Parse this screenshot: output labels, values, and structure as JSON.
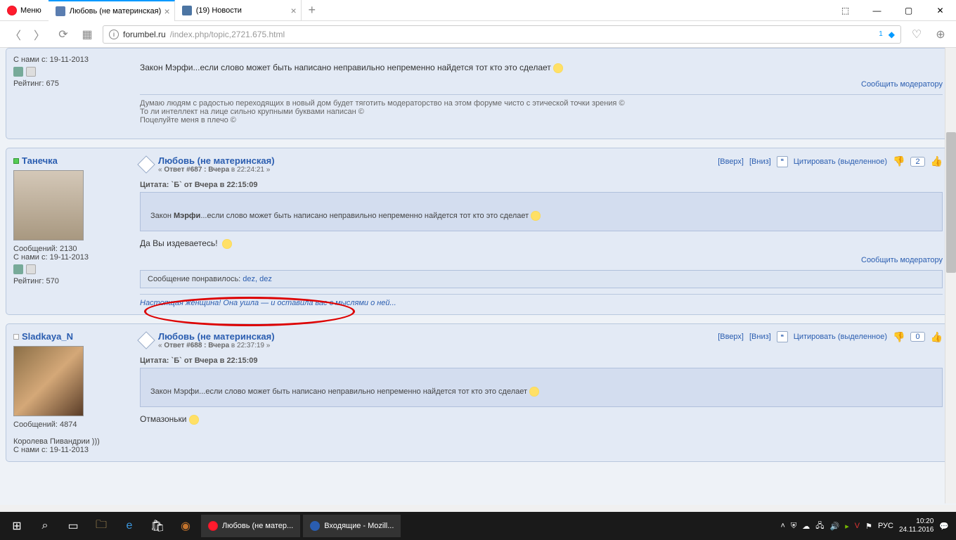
{
  "browser": {
    "menu_label": "Меню",
    "tabs": [
      {
        "title": "Любовь (не материнская)",
        "active": true
      },
      {
        "title": "(19) Новости",
        "active": false
      }
    ],
    "url_domain": "forumbel.ru",
    "url_path": "/index.php/topic,2721.675.html",
    "badge_count": "1"
  },
  "posts": [
    {
      "joined_label": "С нами с:",
      "joined_date": "19-11-2013",
      "rating_label": "Рейтинг:",
      "rating": "675",
      "body": "Закон Мэрфи...если слово может быть написано неправильно непременно найдется тот кто это сделает",
      "report": "Сообщить модератору",
      "sig1": "Думаю людям с радостью переходящих в новый дом будет тяготить модераторство на этом форуме чисто с этической точки зрения ©",
      "sig2": "То ли интеллект на лице сильно крупными буквами написан ©",
      "sig3": "Поцелуйте меня в плечо ©"
    },
    {
      "username": "Танечка",
      "online": true,
      "posts_label": "Сообщений:",
      "posts_count": "2130",
      "joined_label": "С нами с:",
      "joined_date": "19-11-2013",
      "rating_label": "Рейтинг:",
      "rating": "570",
      "title": "Любовь (не материнская)",
      "meta_prefix": "« ",
      "reply_label": "Ответ #687 : Вчера",
      "reply_time": " в 22:24:21 »",
      "quote_header": "Цитата: `Б` от Вчера в 22:15:09",
      "quote_prefix": "Закон ",
      "quote_bold": "Мэрфи",
      "quote_rest": "...если слово может быть написано неправильно непременно найдется тот кто это сделает",
      "body": "Да Вы издеваетесь!",
      "report": "Сообщить модератору",
      "liked_label": "Сообщение понравилось: ",
      "liked_users": "dez, dez",
      "signature": "Настоящая женщина! Она ушла — и оставила вас с мыслями о ней...",
      "actions": {
        "up": "[Вверх]",
        "down": "[Вниз]",
        "quote": "Цитировать (выделенное)",
        "likes": "2"
      }
    },
    {
      "username": "Sladkaya_N",
      "online": false,
      "posts_label": "Сообщений:",
      "posts_count": "4874",
      "extra_line": "Королева Пивандрии )))",
      "joined_label": "С нами с:",
      "joined_date": "19-11-2013",
      "title": "Любовь (не материнская)",
      "reply_label": "Ответ #688 : Вчера",
      "reply_time": " в 22:37:19 »",
      "quote_header": "Цитата: `Б` от Вчера в 22:15:09",
      "quote_text": "Закон Мэрфи...если слово может быть написано неправильно непременно найдется тот кто это сделает",
      "body": "Отмазоньки",
      "actions": {
        "up": "[Вверх]",
        "down": "[Вниз]",
        "quote": "Цитировать (выделенное)",
        "likes": "0"
      }
    }
  ],
  "taskbar": {
    "app1": "Любовь (не матер...",
    "app2": "Входящие - Mozill...",
    "lang": "РУС",
    "time": "10:20",
    "date": "24.11.2016"
  }
}
